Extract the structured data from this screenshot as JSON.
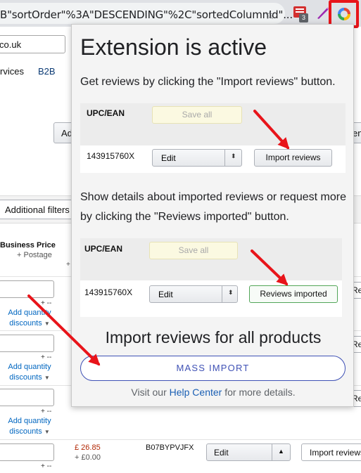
{
  "browser": {
    "url_fragment": "B\"sortOrder\"%3A\"DESCENDING\"%2C\"sortedColumnId\"...",
    "extension_badge": "3"
  },
  "page": {
    "domain": "co.uk",
    "nav": [
      "rvices",
      "B2B"
    ],
    "stub_left": "Ad",
    "stub_right": "en",
    "filters_label": "Additional filters",
    "col_header": "Business Price",
    "col_sub": "+ Postage",
    "col_plus": "+",
    "dash": "+ --",
    "qty_link": "Add quantity discounts",
    "right_btn": "Revi",
    "bottom_row": {
      "price": "£ 26.85",
      "postage": "+ £0.00",
      "sku": "B07BYPVJFX",
      "select": "Edit",
      "import_btn": "Import reviews"
    }
  },
  "popup": {
    "title": "Extension is active",
    "instruction1": "Get reviews by clicking the \"Import reviews\" button.",
    "instruction2": "Show details about imported reviews or request more by clicking the \"Reviews imported\" button.",
    "example1": {
      "col_label": "UPC/EAN",
      "save_label": "Save all",
      "sku": "143915760X",
      "select_value": "Edit",
      "button_label": "Import reviews"
    },
    "example2": {
      "col_label": "UPC/EAN",
      "save_label": "Save all",
      "sku": "143915760X",
      "select_value": "Edit",
      "button_label": "Reviews imported"
    },
    "mass_title": "Import reviews for all products",
    "mass_button": "MASS IMPORT",
    "help_prefix": "Visit our ",
    "help_link": "Help Center",
    "help_suffix": " for more details."
  },
  "colors": {
    "highlight": "#e8141a",
    "mass_button": "#3f51b5",
    "link": "#1a5fb4"
  }
}
